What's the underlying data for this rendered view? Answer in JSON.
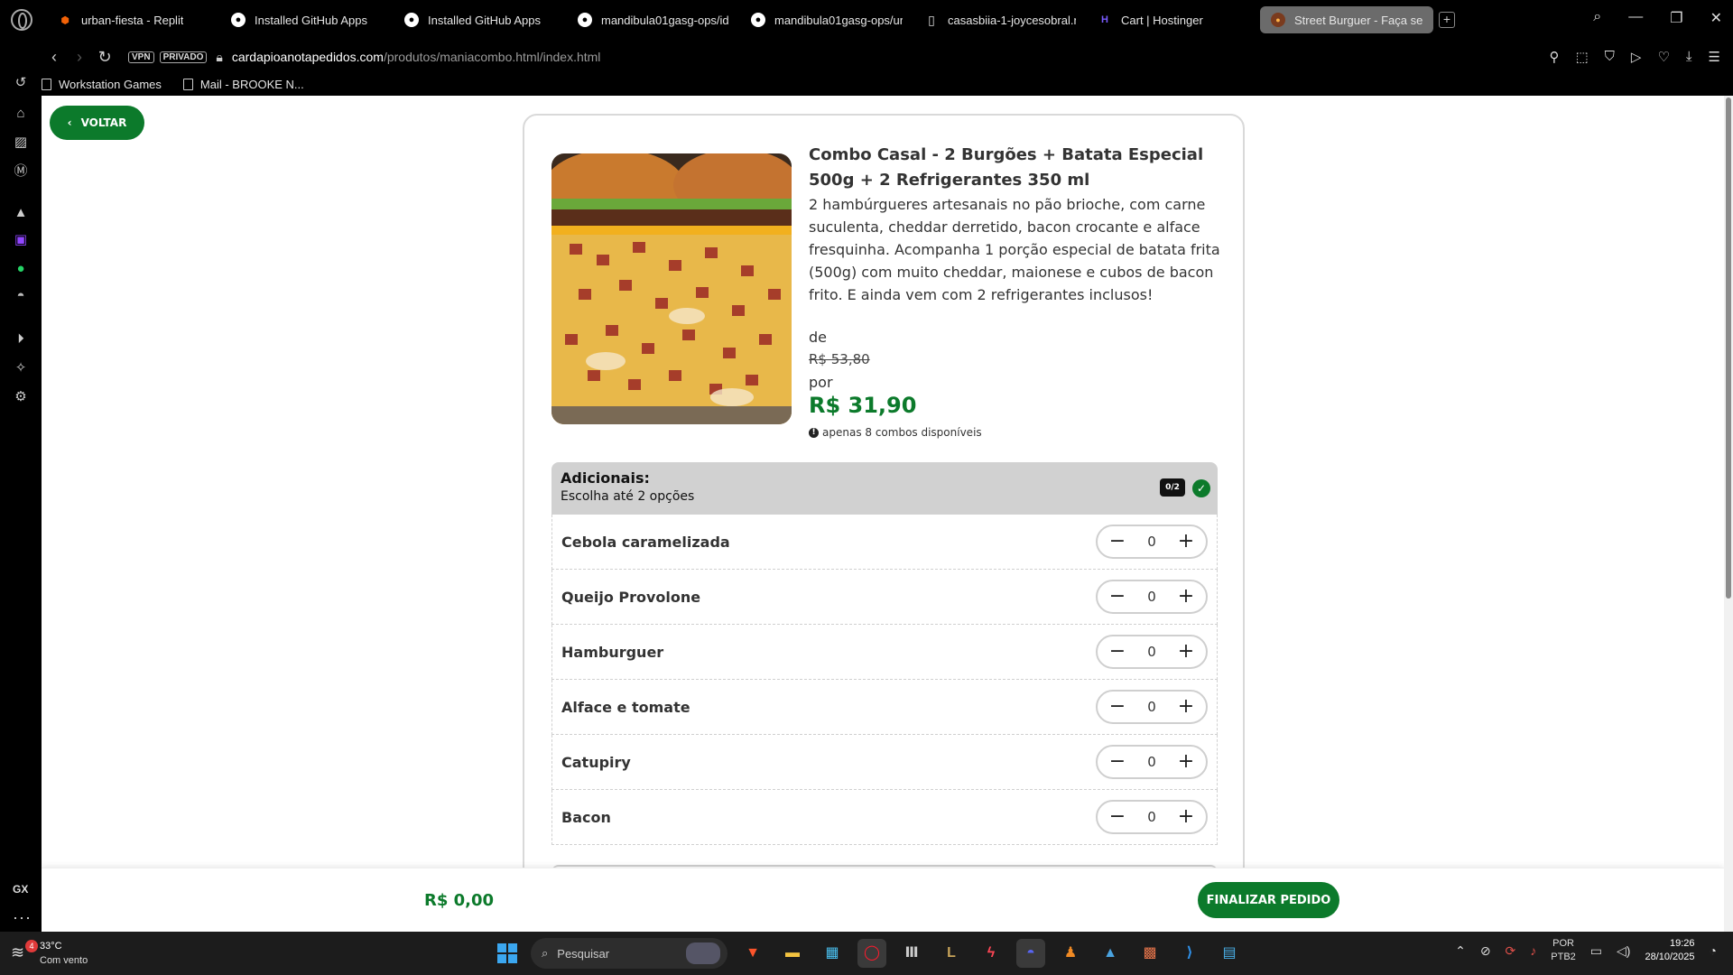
{
  "browser": {
    "tabs": [
      {
        "label": "urban-fiesta - Replit",
        "icon": "replit-icon"
      },
      {
        "label": "Installed GitHub Apps",
        "icon": "github-icon"
      },
      {
        "label": "Installed GitHub Apps",
        "icon": "github-icon"
      },
      {
        "label": "mandibula01gasg-ops/ide",
        "icon": "github-icon"
      },
      {
        "label": "mandibula01gasg-ops/ur",
        "icon": "github-icon"
      },
      {
        "label": "casasbiia-1-joycesobral.n",
        "icon": "document-icon"
      },
      {
        "label": "Cart | Hostinger",
        "icon": "hostinger-icon"
      },
      {
        "label": "Street Burguer - Faça seu",
        "icon": "burger-icon",
        "active": true
      }
    ],
    "vpn_label": "VPN",
    "private_label": "PRIVADO",
    "url_domain": "cardapioanotapedidos.com",
    "url_path": "/produtos/maniacombo.html/index.html",
    "bookmarks": [
      {
        "label": "Workstation Games"
      },
      {
        "label": "Mail - BROOKE N..."
      }
    ],
    "sidebar_gx": "GX"
  },
  "page": {
    "back_label": "VOLTAR",
    "product": {
      "title": "Combo Casal - 2 Burgões + Batata Especial 500g + 2 Refrigerantes 350 ml",
      "description": "2 hambúrgueres artesanais no pão brioche, com carne suculenta, cheddar derretido, bacon crocante e alface fresquinha. Acompanha 1 porção especial de batata frita (500g) com muito cheddar, maionese e cubos de bacon frito. E ainda vem com 2 refrigerantes inclusos!",
      "from_label": "de",
      "old_price": "R$ 53,80",
      "to_label": "por",
      "price": "R$ 31,90",
      "stock_text": "apenas 8 combos disponíveis"
    },
    "addons": {
      "title": "Adicionais:",
      "subtitle": "Escolha até 2 opções",
      "counter": "0/2",
      "items": [
        {
          "name": "Cebola caramelizada",
          "qty": "0"
        },
        {
          "name": "Queijo Provolone",
          "qty": "0"
        },
        {
          "name": "Hamburguer",
          "qty": "0"
        },
        {
          "name": "Alface e tomate",
          "qty": "0"
        },
        {
          "name": "Catupiry",
          "qty": "0"
        },
        {
          "name": "Bacon",
          "qty": "0"
        }
      ]
    },
    "footer": {
      "total": "R$ 0,00",
      "checkout_label": "FINALIZAR PEDIDO"
    },
    "colors": {
      "accent": "#0c7a2b",
      "header_bg": "#d1d1d1"
    }
  },
  "taskbar": {
    "weather_temp": "33°C",
    "weather_desc": "Com vento",
    "weather_badge": "4",
    "search_placeholder": "Pesquisar",
    "lang_top": "POR",
    "lang_bottom": "PTB2",
    "time": "19:26",
    "date": "28/10/2025"
  }
}
